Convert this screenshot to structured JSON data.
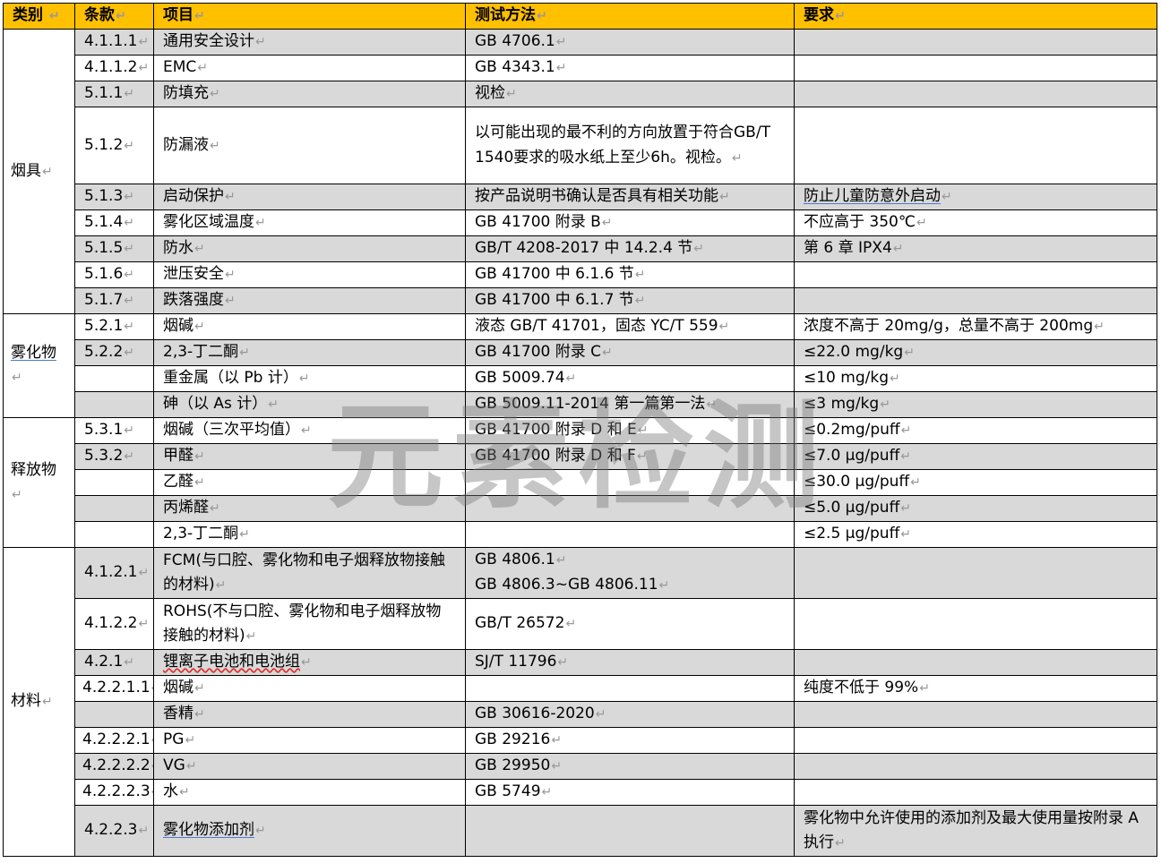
{
  "header": {
    "category": "类别",
    "clause": "条款",
    "item": "项目",
    "method": "测试方法",
    "requirement": "要求"
  },
  "categories": {
    "yanju": "烟具",
    "wuhuawu": "雾化物",
    "shifangwu": "释放物",
    "cailiao": "材料"
  },
  "rows": [
    {
      "clause": "4.1.1.1",
      "item": "通用安全设计",
      "method": "GB 4706.1",
      "req": ""
    },
    {
      "clause": "4.1.1.2",
      "item": "EMC",
      "method": "GB 4343.1",
      "req": ""
    },
    {
      "clause": "5.1.1",
      "item": "防填充",
      "method": "视检",
      "req": ""
    },
    {
      "clause": "5.1.2",
      "item": "防漏液",
      "method": "以可能出现的最不利的方向放置于符合GB/T 1540要求的吸水纸上至少6h。视检。",
      "req": ""
    },
    {
      "clause": "5.1.3",
      "item": "启动保护",
      "method": "按产品说明书确认是否具有相关功能",
      "req": "防止儿童防意外启动"
    },
    {
      "clause": "5.1.4",
      "item": "雾化区域温度",
      "method": "GB 41700  附录  B",
      "req": "不应高于 350℃"
    },
    {
      "clause": "5.1.5",
      "item": "防水",
      "method": "GB/T 4208-2017  中 14.2.4 节",
      "req": "第 6 章  IPX4"
    },
    {
      "clause": "5.1.6",
      "item": "泄压安全",
      "method": "GB 41700 中 6.1.6 节",
      "req": ""
    },
    {
      "clause": "5.1.7",
      "item": "跌落强度",
      "method": "GB 41700 中 6.1.7 节",
      "req": ""
    },
    {
      "clause": "5.2.1",
      "item": "烟碱",
      "method": "液态 GB/T 41701，固态 YC/T 559",
      "req": "浓度不高于 20mg/g，总量不高于 200mg"
    },
    {
      "clause": "5.2.2",
      "item": "2,3-丁二酮",
      "method": "GB 41700  附录  C",
      "req": "≤22.0 mg/kg"
    },
    {
      "clause": "",
      "item": "重金属（以 Pb 计）",
      "method": "GB 5009.74",
      "req": "≤10 mg/kg"
    },
    {
      "clause": "",
      "item": "砷（以 As 计）",
      "method": "GB 5009.11-2014  第一篇第一法",
      "req": "≤3 mg/kg"
    },
    {
      "clause": "5.3.1",
      "item": "烟碱（三次平均值）",
      "method": "GB 41700  附录  D 和 E",
      "req": "≤0.2mg/puff"
    },
    {
      "clause": "5.3.2",
      "item": "甲醛",
      "method": "GB 41700  附录  D 和 F",
      "req": "≤7.0  μg/puff"
    },
    {
      "clause": "",
      "item": "乙醛",
      "method": "",
      "req": "≤30.0  μg/puff"
    },
    {
      "clause": "",
      "item": "丙烯醛",
      "method": "",
      "req": "≤5.0  μg/puff"
    },
    {
      "clause": "",
      "item": "2,3-丁二酮",
      "method": "",
      "req": "≤2.5  μg/puff"
    },
    {
      "clause": "4.1.2.1",
      "item": "FCM(与口腔、雾化物和电子烟释放物接触的材料)",
      "method": "GB 4806.1",
      "method2": "GB 4806.3~GB 4806.11",
      "req": ""
    },
    {
      "clause": "4.1.2.2",
      "item": "ROHS(不与口腔、雾化物和电子烟释放物接触的材料)",
      "method": "GB/T 26572",
      "req": ""
    },
    {
      "clause": "4.2.1",
      "item": "锂离子电池和电池组",
      "method": "SJ/T 11796",
      "req": ""
    },
    {
      "clause": "4.2.2.1.1",
      "item": "烟碱",
      "method": "",
      "req": "纯度不低于 99%"
    },
    {
      "clause": "",
      "item": "香精",
      "method": "GB 30616-2020",
      "req": ""
    },
    {
      "clause": "4.2.2.2.1",
      "item": "PG",
      "method": "GB 29216",
      "req": ""
    },
    {
      "clause": "4.2.2.2.2",
      "item": "VG",
      "method": "GB 29950",
      "req": ""
    },
    {
      "clause": "4.2.2.2.3",
      "item": "水",
      "method": "GB 5749",
      "req": ""
    },
    {
      "clause": "4.2.2.3",
      "item": "雾化物添加剂",
      "method": "",
      "req": "雾化物中允许使用的添加剂及最大使用量按附录 A 执行"
    }
  ],
  "paragraph_mark": "↵",
  "watermark": "元素检测"
}
